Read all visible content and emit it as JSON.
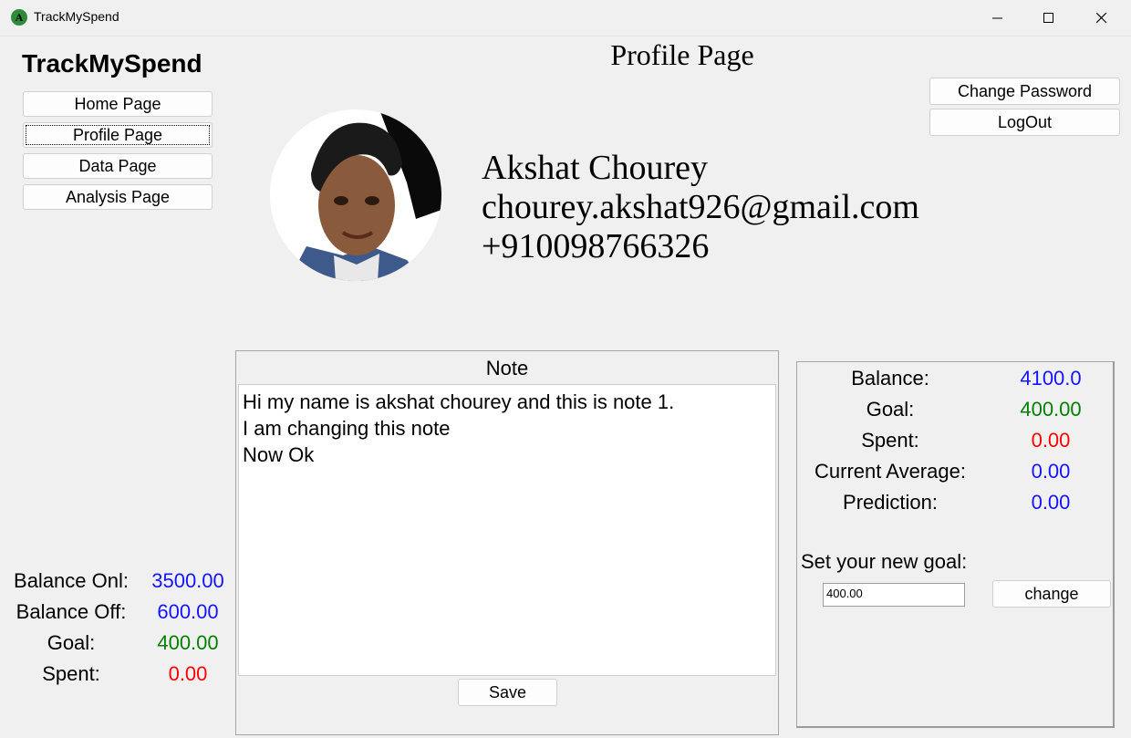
{
  "window": {
    "title": "TrackMySpend",
    "icon": "app-logo-icon",
    "icon_glyph": "A"
  },
  "sidebar": {
    "brand": "TrackMySpend",
    "items": [
      {
        "label": "Home Page"
      },
      {
        "label": "Profile Page",
        "active": true
      },
      {
        "label": "Data Page"
      },
      {
        "label": "Analysis Page"
      }
    ]
  },
  "header": {
    "title": "Profile Page",
    "change_password_label": "Change Password",
    "logout_label": "LogOut"
  },
  "profile": {
    "name": "Akshat Chourey",
    "email": "chourey.akshat926@gmail.com",
    "phone": "+910098766326"
  },
  "note": {
    "title": "Note",
    "text": "Hi my name is akshat chourey and this is note 1.\nI am changing this note\nNow Ok",
    "save_label": "Save"
  },
  "stats": {
    "rows": [
      {
        "label": "Balance:",
        "value": "4100.0",
        "color": "#1414ff"
      },
      {
        "label": "Goal:",
        "value": "400.00",
        "color": "#008000"
      },
      {
        "label": "Spent:",
        "value": "0.00",
        "color": "#ff0000"
      },
      {
        "label": "Current Average:",
        "value": "0.00",
        "color": "#1414ff"
      },
      {
        "label": "Prediction:",
        "value": "0.00",
        "color": "#1414ff"
      }
    ],
    "goal_prompt": "Set your new goal:",
    "goal_input_value": "400.00",
    "change_label": "change"
  },
  "summary": {
    "rows": [
      {
        "label": "Balance Onl:",
        "value": "3500.00",
        "color": "#1414ff"
      },
      {
        "label": "Balance Off:",
        "value": "600.00",
        "color": "#1414ff"
      },
      {
        "label": "Goal:",
        "value": "400.00",
        "color": "#008000"
      },
      {
        "label": "Spent:",
        "value": "0.00",
        "color": "#ff0000"
      }
    ]
  }
}
